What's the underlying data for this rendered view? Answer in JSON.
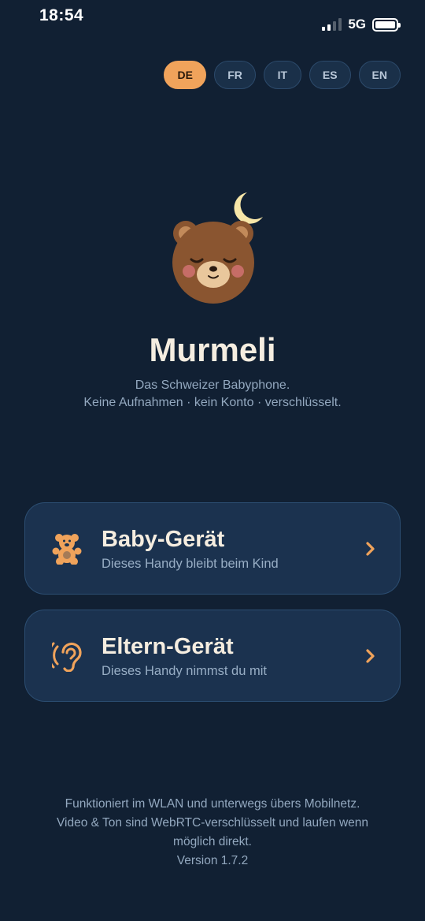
{
  "status_bar": {
    "time": "18:54",
    "network": "5G",
    "icons": [
      "signal-icon",
      "battery-icon"
    ]
  },
  "languages": [
    {
      "code": "DE",
      "active": true
    },
    {
      "code": "FR",
      "active": false
    },
    {
      "code": "IT",
      "active": false
    },
    {
      "code": "ES",
      "active": false
    },
    {
      "code": "EN",
      "active": false
    }
  ],
  "app": {
    "name": "Murmeli",
    "tagline_line1": "Das Schweizer Babyphone.",
    "tagline_line2": "Keine Aufnahmen · kein Konto · verschlüsselt.",
    "logo_icon": "sleeping-bear-moon-icon"
  },
  "options": {
    "baby": {
      "title": "Baby-Gerät",
      "subtitle": "Dieses Handy bleibt beim Kind",
      "icon": "teddy-bear-icon"
    },
    "parent": {
      "title": "Eltern-Gerät",
      "subtitle": "Dieses Handy nimmst du mit",
      "icon": "ear-icon"
    }
  },
  "footer": {
    "line1": "Funktioniert im WLAN und unterwegs übers Mobilnetz.",
    "line2": "Video & Ton sind WebRTC-verschlüsselt und laufen wenn",
    "line3": "möglich direkt.",
    "version": "Version 1.7.2"
  },
  "colors": {
    "background": "#112033",
    "accent": "#f0a35b",
    "card": "#1b324f",
    "title_text": "#f5ede0",
    "muted_text": "#93a8bf"
  }
}
